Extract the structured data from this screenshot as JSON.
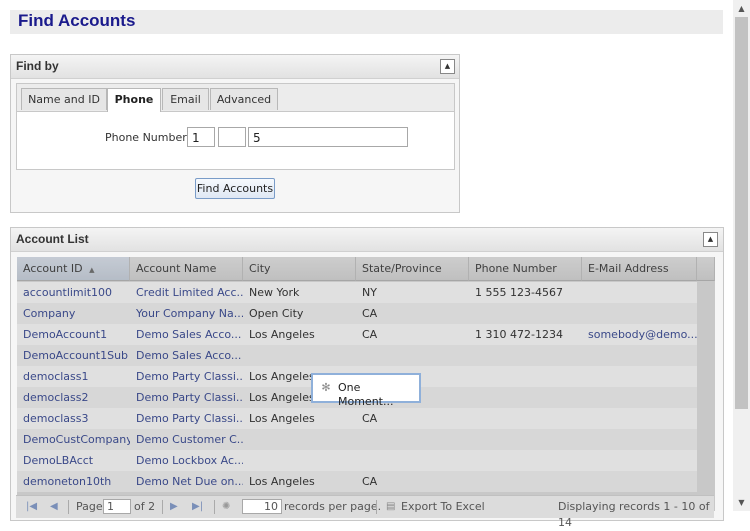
{
  "page": {
    "title": "Find Accounts"
  },
  "find_by": {
    "title": "Find by",
    "tabs": [
      "Name and ID",
      "Phone",
      "Email",
      "Advanced"
    ],
    "phone_label": "Phone Number:",
    "phone_country": "1",
    "phone_area": "",
    "phone_number": "5",
    "find_button": "Find Accounts"
  },
  "account_list": {
    "title": "Account List",
    "columns": [
      "Account ID",
      "Account Name",
      "City",
      "State/Province",
      "Phone Number",
      "E-Mail Address"
    ],
    "sort_indicator": "▲",
    "rows": [
      [
        "accountlimit100",
        "Credit Limited Acc...",
        "New York",
        "NY",
        "1 555 123-4567",
        ""
      ],
      [
        "Company",
        "Your Company Na...",
        "Open City",
        "CA",
        "",
        ""
      ],
      [
        "DemoAccount1",
        "Demo Sales Acco...",
        "Los Angeles",
        "CA",
        "1 310 472-1234",
        "somebody@demo..."
      ],
      [
        "DemoAccount1Sub",
        "Demo Sales Acco...",
        "",
        "",
        "",
        ""
      ],
      [
        "democlass1",
        "Demo Party Classi...",
        "Los Angeles",
        "",
        "",
        ""
      ],
      [
        "democlass2",
        "Demo Party Classi...",
        "Los Angeles",
        "",
        "",
        ""
      ],
      [
        "democlass3",
        "Demo Party Classi...",
        "Los Angeles",
        "CA",
        "",
        ""
      ],
      [
        "DemoCustCompany",
        "Demo Customer C...",
        "",
        "",
        "",
        ""
      ],
      [
        "DemoLBAcct",
        "Demo Lockbox Ac...",
        "",
        "",
        "",
        ""
      ],
      [
        "demoneton10th",
        "Demo Net Due on...",
        "Los Angeles",
        "CA",
        "",
        ""
      ]
    ],
    "pager": {
      "page_label": "Page",
      "page_value": "1",
      "of_label": "of 2",
      "per_page_value": "10",
      "per_page_label": "records per page.",
      "export_label": "Export To Excel",
      "display_info": "Displaying records 1 - 10 of 14"
    }
  },
  "loading": {
    "text": "One Moment..."
  }
}
